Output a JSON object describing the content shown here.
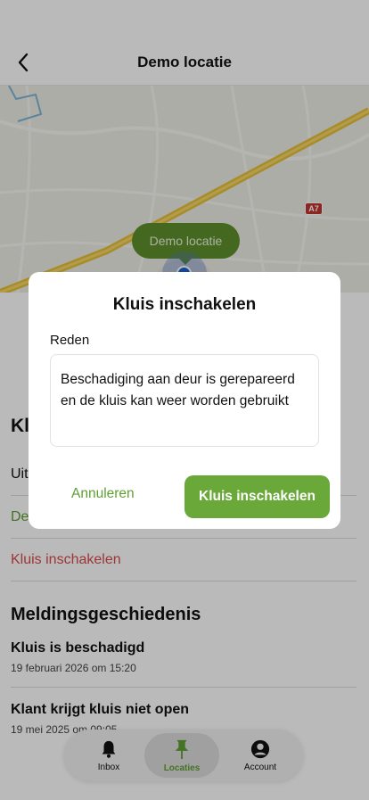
{
  "header": {
    "title": "Demo locatie",
    "back_icon": "chevron-left-icon"
  },
  "map": {
    "pin_label": "Demo locatie",
    "road_shield": "A7",
    "colors": {
      "pin": "#1a5fd6",
      "label_bg": "#5f8f2e",
      "road": "#e8c03a"
    }
  },
  "kluis": {
    "heading": "Kluis",
    "rows": [
      "Uit",
      "De",
      "Kluis inschakelen"
    ]
  },
  "history": {
    "title": "Meldingsgeschiedenis",
    "items": [
      {
        "title": "Kluis is beschadigd",
        "date": "19 februari 2026 om 15:20"
      },
      {
        "title": "Klant krijgt kluis niet open",
        "date": "19 mei 2025 om 09:05"
      }
    ]
  },
  "tabs": [
    {
      "label": "Inbox",
      "icon": "bell-icon"
    },
    {
      "label": "Locaties",
      "icon": "pin-icon",
      "active": true
    },
    {
      "label": "Account",
      "icon": "account-icon"
    }
  ],
  "dialog": {
    "title": "Kluis inschakelen",
    "field_label": "Reden",
    "field_value": "Beschadiging aan deur is gerepareerd en de kluis kan weer worden gebruikt",
    "cancel_label": "Annuleren",
    "confirm_label": "Kluis inschakelen",
    "colors": {
      "accent": "#6aa83a",
      "danger": "#d84a4a"
    }
  }
}
